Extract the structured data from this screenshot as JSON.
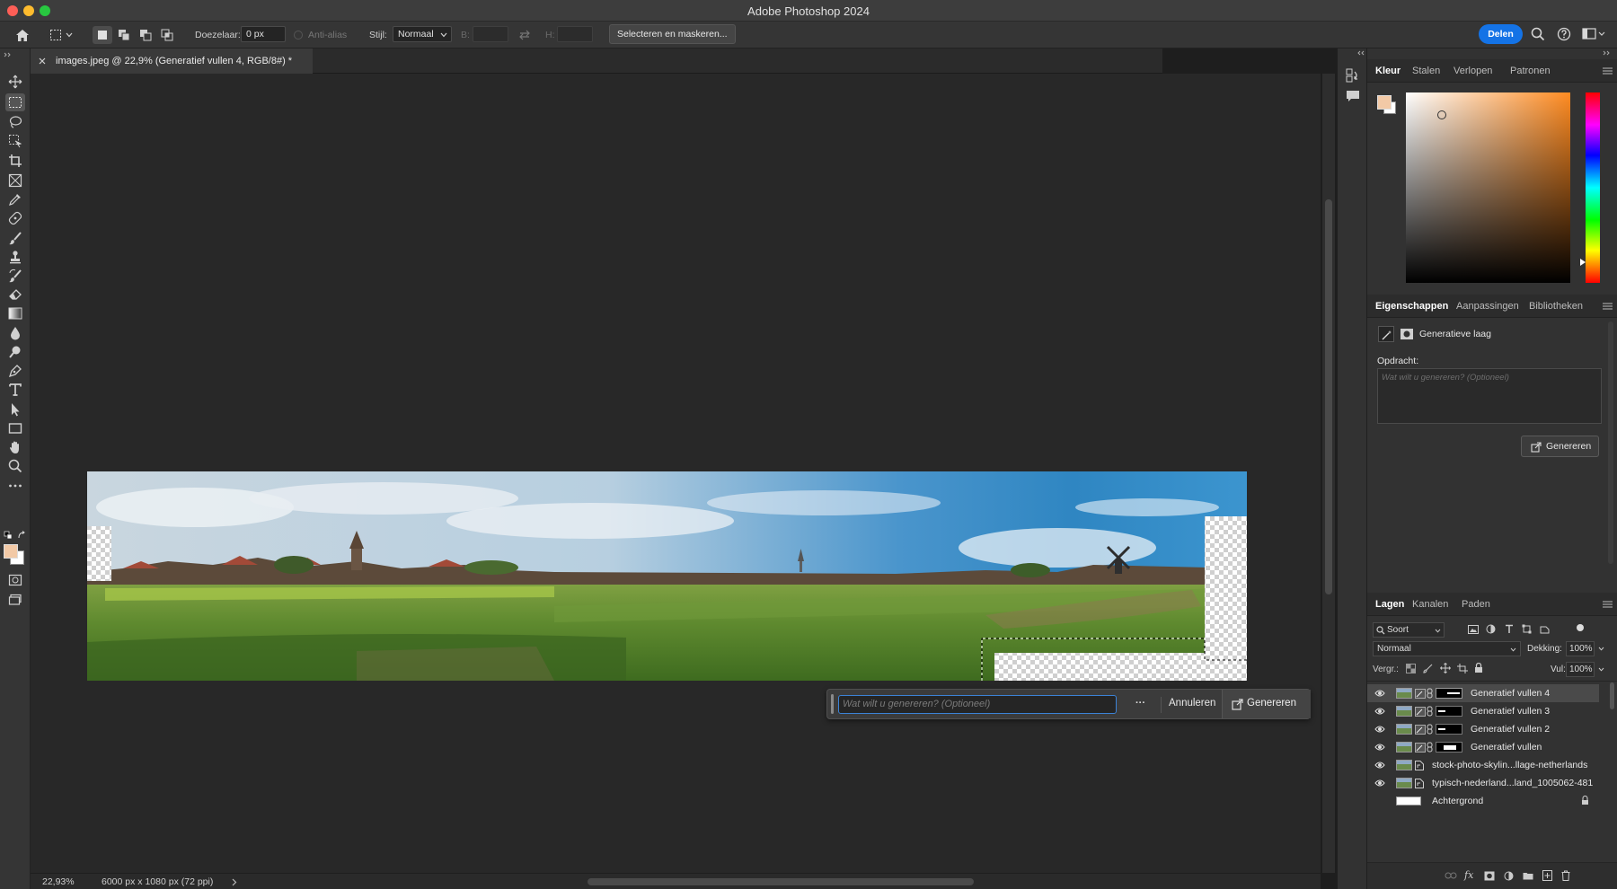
{
  "window": {
    "title": "Adobe Photoshop 2024"
  },
  "options": {
    "feather_label": "Doezelaar:",
    "feather_value": "0 px",
    "antialias_label": "Anti-alias",
    "style_label": "Stijl:",
    "style_value": "Normaal",
    "width_label": "B:",
    "height_label": "H:",
    "select_mask_label": "Selecteren en maskeren...",
    "share_label": "Delen"
  },
  "document": {
    "tab_title": "images.jpeg @ 22,9% (Generatief vullen 4, RGB/8#) *",
    "zoom": "22,93%",
    "info": "6000 px x 1080 px (72 ppi)"
  },
  "contextual_bar": {
    "prompt_placeholder": "Wat wilt u genereren?  (Optioneel)",
    "more_label": "···",
    "cancel_label": "Annuleren",
    "generate_label": "Genereren"
  },
  "color_panel": {
    "tabs": [
      "Kleur",
      "Stalen",
      "Verlopen",
      "Patronen"
    ],
    "foreground": "#f2c9a6",
    "background": "#ffffff"
  },
  "properties_panel": {
    "tabs": [
      "Eigenschappen",
      "Aanpassingen",
      "Bibliotheken"
    ],
    "layer_type": "Generatieve laag",
    "prompt_label": "Opdracht:",
    "prompt_placeholder": "Wat wilt u genereren?  (Optioneel)",
    "generate_label": "Genereren"
  },
  "layers_panel": {
    "tabs": [
      "Lagen",
      "Kanalen",
      "Paden"
    ],
    "filter_label": "Soort",
    "blend_mode": "Normaal",
    "opacity_label": "Dekking:",
    "opacity_value": "100%",
    "lock_label": "Vergr.:",
    "fill_label": "Vul:",
    "fill_value": "100%",
    "layers": [
      {
        "name": "Generatief vullen 4",
        "selected": true
      },
      {
        "name": "Generatief vullen 3",
        "selected": false
      },
      {
        "name": "Generatief vullen 2",
        "selected": false
      },
      {
        "name": "Generatief vullen",
        "selected": false
      },
      {
        "name": "stock-photo-skylin...llage-netherlands",
        "selected": false
      },
      {
        "name": "typisch-nederland...land_1005062-481",
        "selected": false
      },
      {
        "name": "Achtergrond",
        "selected": false
      }
    ]
  },
  "colors": {
    "accent": "#1473e6",
    "canvas_bg": "#282828"
  }
}
